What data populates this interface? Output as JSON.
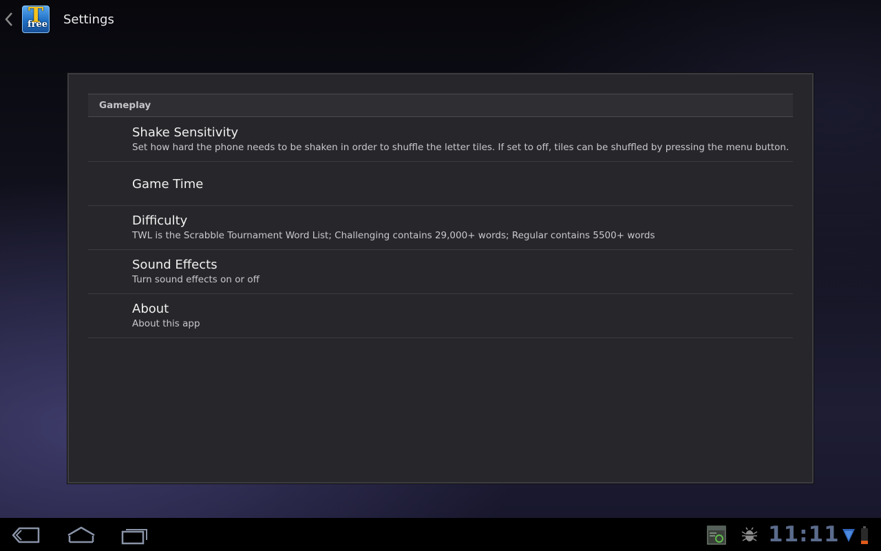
{
  "action_bar": {
    "title": "Settings",
    "app_icon": {
      "letter": "T",
      "badge": "free"
    }
  },
  "dialog": {
    "category": "Gameplay",
    "preferences": [
      {
        "title": "Shake Sensitivity",
        "summary": "Set how hard the phone needs to be shaken in order to shuffle the letter tiles. If set to off, tiles can be shuffled by pressing the menu button."
      },
      {
        "title": "Game Time",
        "summary": ""
      },
      {
        "title": "Difficulty",
        "summary": "TWL is the Scrabble Tournament Word List; Challenging contains 29,000+ words; Regular contains 5500+ words"
      },
      {
        "title": "Sound Effects",
        "summary": "Turn sound effects on or off"
      },
      {
        "title": "About",
        "summary": "About this app"
      }
    ]
  },
  "system_bar": {
    "time": "11:11",
    "icons": [
      "back-icon",
      "home-icon",
      "recent-apps-icon",
      "screenshot-notification-icon",
      "usb-debugging-icon",
      "wifi-icon",
      "battery-icon"
    ]
  },
  "colors": {
    "dialog_bg": "#27272b",
    "clock": "#5a6b8c",
    "battery_low": "#e05a1a",
    "wifi": "#3a78c8"
  }
}
